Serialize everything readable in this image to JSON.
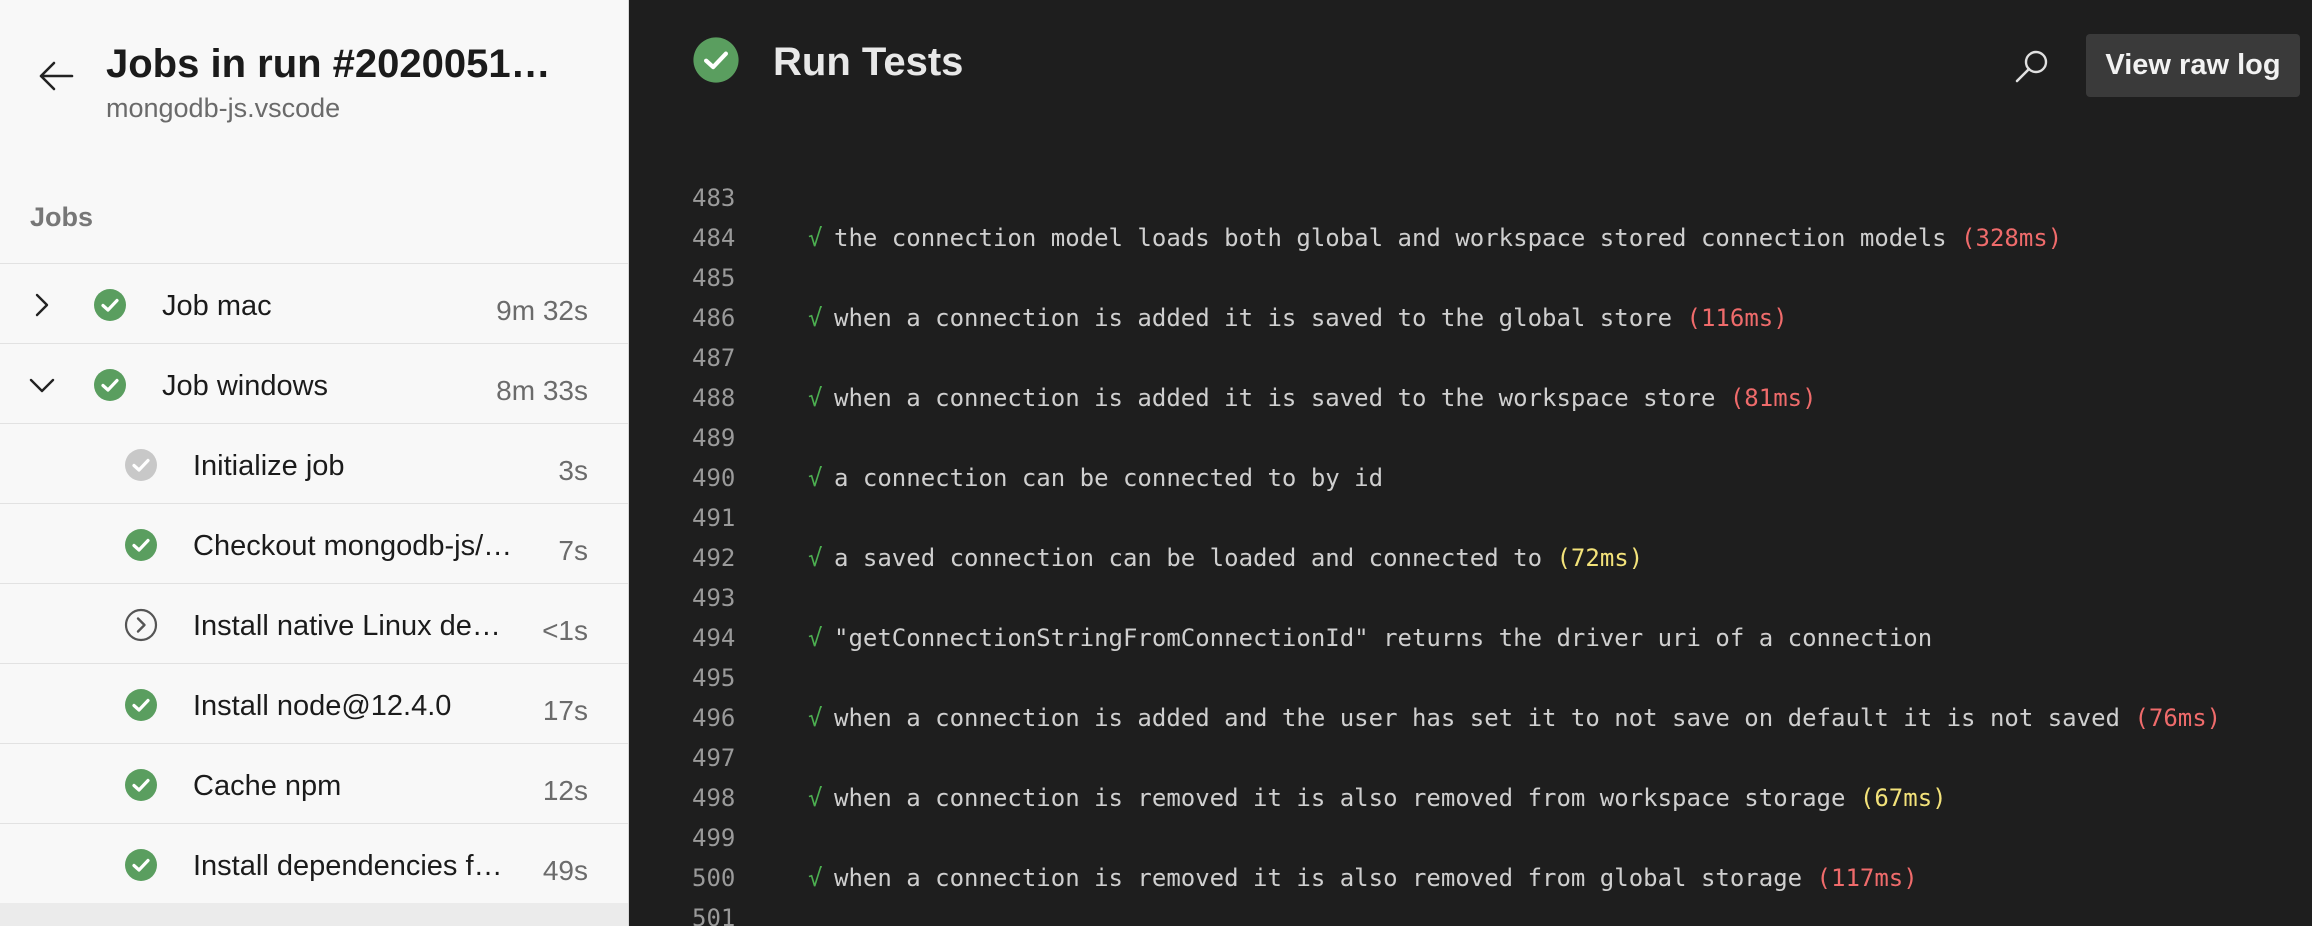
{
  "sidebar": {
    "title": "Jobs in run #2020051…",
    "subtitle": "mongodb-js.vscode",
    "section": "Jobs",
    "jobs": [
      {
        "label": "Job mac",
        "duration": "9m 32s",
        "status": "success",
        "expanded": false
      },
      {
        "label": "Job windows",
        "duration": "8m 33s",
        "status": "success",
        "expanded": true
      }
    ],
    "steps": [
      {
        "label": "Initialize job",
        "duration": "3s",
        "status": "neutral"
      },
      {
        "label": "Checkout mongodb-js/…",
        "duration": "7s",
        "status": "success"
      },
      {
        "label": "Install native Linux dep…",
        "duration": "<1s",
        "status": "skipped"
      },
      {
        "label": "Install node@12.4.0",
        "duration": "17s",
        "status": "success"
      },
      {
        "label": "Cache npm",
        "duration": "12s",
        "status": "success"
      },
      {
        "label": "Install dependencies f…",
        "duration": "49s",
        "status": "success"
      }
    ]
  },
  "main": {
    "title": "Run Tests",
    "view_raw_label": "View raw log",
    "log_lines": [
      {
        "num": "483",
        "check": "",
        "text": "",
        "time": "",
        "time_color": ""
      },
      {
        "num": "484",
        "check": "√",
        "text": "the connection model loads both global and workspace stored connection models ",
        "time": "(328ms)",
        "time_color": "red"
      },
      {
        "num": "485",
        "check": "",
        "text": "",
        "time": "",
        "time_color": ""
      },
      {
        "num": "486",
        "check": "√",
        "text": "when a connection is added it is saved to the global store ",
        "time": "(116ms)",
        "time_color": "red"
      },
      {
        "num": "487",
        "check": "",
        "text": "",
        "time": "",
        "time_color": ""
      },
      {
        "num": "488",
        "check": "√",
        "text": "when a connection is added it is saved to the workspace store ",
        "time": "(81ms)",
        "time_color": "red"
      },
      {
        "num": "489",
        "check": "",
        "text": "",
        "time": "",
        "time_color": ""
      },
      {
        "num": "490",
        "check": "√",
        "text": "a connection can be connected to by id",
        "time": "",
        "time_color": ""
      },
      {
        "num": "491",
        "check": "",
        "text": "",
        "time": "",
        "time_color": ""
      },
      {
        "num": "492",
        "check": "√",
        "text": "a saved connection can be loaded and connected to ",
        "time": "(72ms)",
        "time_color": "yellow"
      },
      {
        "num": "493",
        "check": "",
        "text": "",
        "time": "",
        "time_color": ""
      },
      {
        "num": "494",
        "check": "√",
        "text": "\"getConnectionStringFromConnectionId\" returns the driver uri of a connection",
        "time": "",
        "time_color": ""
      },
      {
        "num": "495",
        "check": "",
        "text": "",
        "time": "",
        "time_color": ""
      },
      {
        "num": "496",
        "check": "√",
        "text": "when a connection is added and the user has set it to not save on default it is not saved ",
        "time": "(76ms)",
        "time_color": "red"
      },
      {
        "num": "497",
        "check": "",
        "text": "",
        "time": "",
        "time_color": ""
      },
      {
        "num": "498",
        "check": "√",
        "text": "when a connection is removed it is also removed from workspace storage ",
        "time": "(67ms)",
        "time_color": "yellow"
      },
      {
        "num": "499",
        "check": "",
        "text": "",
        "time": "",
        "time_color": ""
      },
      {
        "num": "500",
        "check": "√",
        "text": "when a connection is removed it is also removed from global storage ",
        "time": "(117ms)",
        "time_color": "red"
      },
      {
        "num": "501",
        "check": "",
        "text": "",
        "time": "",
        "time_color": ""
      }
    ]
  },
  "colors": {
    "success": "#5a9e5f",
    "neutral": "#c8c8c8",
    "log_red": "#ef6b6b",
    "log_yellow": "#f3e27a",
    "check_green": "#4caf50"
  }
}
